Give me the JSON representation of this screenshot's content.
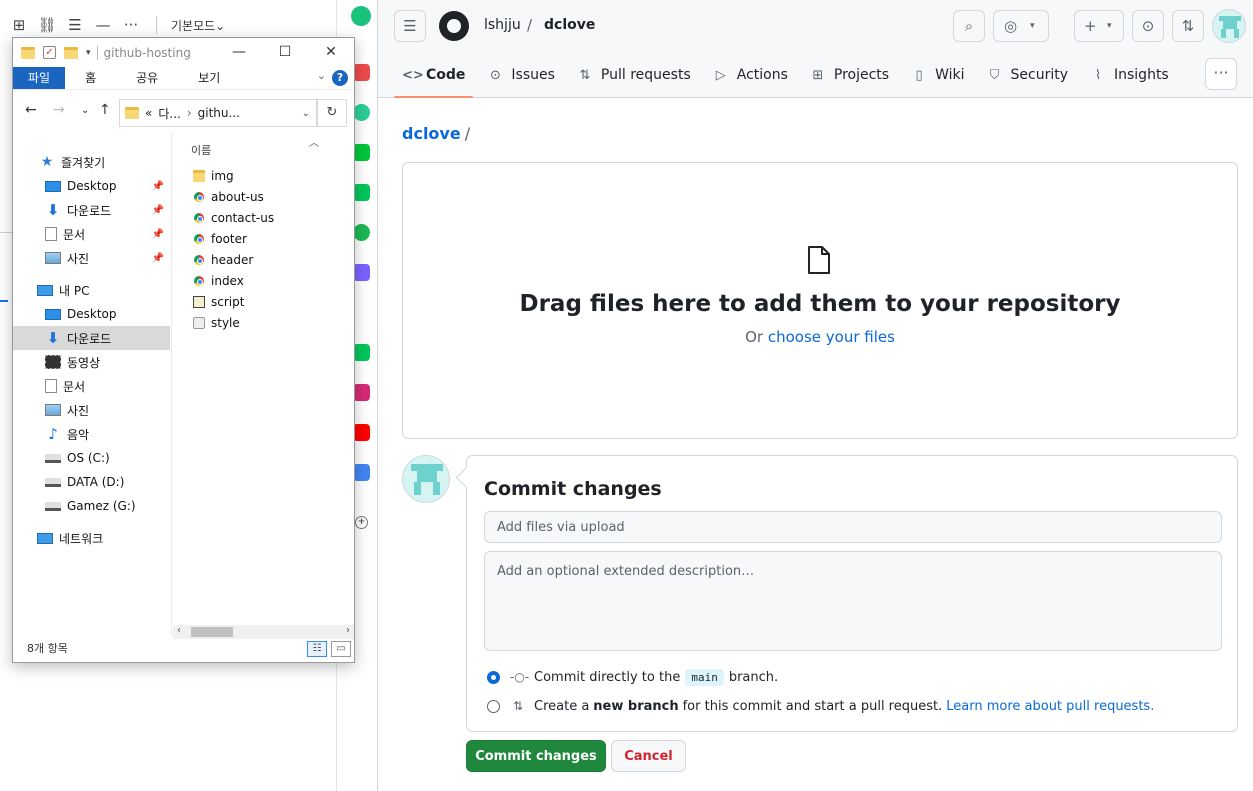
{
  "background_app": {
    "toolbar": {
      "mode_label": "기본모드",
      "chevron": "⌄",
      "more": "···"
    }
  },
  "explorer": {
    "title": "github-hosting",
    "ribbon_tabs": [
      "파일",
      "홈",
      "공유",
      "보기"
    ],
    "address": {
      "prefix": "«",
      "segments": [
        "다...",
        "githu..."
      ]
    },
    "column_header": "이름",
    "nav": {
      "favorites_label": "즐겨찾기",
      "favorites": [
        "Desktop",
        "다운로드",
        "문서",
        "사진"
      ],
      "pc_label": "내 PC",
      "pc_items": [
        "Desktop",
        "다운로드",
        "동영상",
        "문서",
        "사진",
        "음악",
        "OS (C:)",
        "DATA (D:)",
        "Gamez (G:)"
      ],
      "network_label": "네트워크"
    },
    "files": [
      "img",
      "about-us",
      "contact-us",
      "footer",
      "header",
      "index",
      "script",
      "style"
    ],
    "status": "8개 항목"
  },
  "github": {
    "owner": "lshjju",
    "repo": "dclove",
    "tabs": [
      "Code",
      "Issues",
      "Pull requests",
      "Actions",
      "Projects",
      "Wiki",
      "Security",
      "Insights"
    ],
    "breadcrumb": {
      "repo": "dclove",
      "sep": "/"
    },
    "dropzone": {
      "title": "Drag files here to add them to your repository",
      "or_text": "Or",
      "choose_link": "choose your files"
    },
    "commit": {
      "title": "Commit changes",
      "summary_placeholder": "Add files via upload",
      "description_placeholder": "Add an optional extended description…",
      "direct_prefix": "Commit directly to the",
      "branch_name": "main",
      "direct_suffix": "branch.",
      "new_prefix": "Create a",
      "new_bold": "new branch",
      "new_suffix": "for this commit and start a pull request.",
      "learn_more": "Learn more about pull requests.",
      "commit_button": "Commit changes",
      "cancel_button": "Cancel"
    },
    "colors": {
      "primary": "#1f883d",
      "link": "#0969da",
      "danger": "#d1242f",
      "tab_underline": "#fd8c73"
    }
  }
}
